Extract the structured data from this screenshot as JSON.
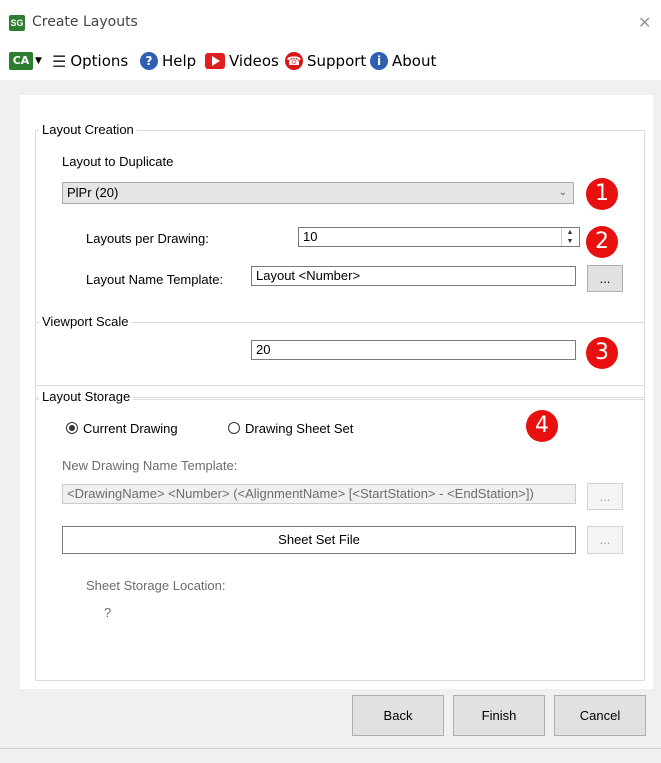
{
  "window": {
    "app_badge": "SG",
    "title": "Create Layouts",
    "close_glyph": "✕"
  },
  "toolbar": {
    "ca_badge": "CA",
    "items": [
      {
        "label": "Options",
        "icon": "list-icon"
      },
      {
        "label": "Help",
        "icon": "help-icon"
      },
      {
        "label": "Videos",
        "icon": "video-icon"
      },
      {
        "label": "Support",
        "icon": "support-icon"
      },
      {
        "label": "About",
        "icon": "info-icon"
      }
    ]
  },
  "layout_creation": {
    "legend": "Layout Creation",
    "duplicate_label": "Layout to Duplicate",
    "duplicate_value": "PlPr (20)",
    "per_drawing_label": "Layouts per Drawing:",
    "per_drawing_value": "10",
    "name_template_label": "Layout Name Template:",
    "name_template_value": "Layout <Number>",
    "browse_label": "..."
  },
  "viewport": {
    "legend": "Viewport Scale",
    "value": "20"
  },
  "storage": {
    "legend": "Layout Storage",
    "radio_current": "Current Drawing",
    "radio_sheet_set": "Drawing Sheet Set",
    "selected": "Current Drawing",
    "new_drawing_label": "New Drawing Name Template:",
    "new_drawing_value": "<DrawingName> <Number> (<AlignmentName> [<StartStation> - <EndStation>])",
    "sheet_set_file": "Sheet Set File",
    "browse_label": "...",
    "location_label": "Sheet Storage Location:",
    "location_value": "?"
  },
  "badges": [
    "1",
    "2",
    "3",
    "4"
  ],
  "footer": {
    "back": "Back",
    "finish": "Finish",
    "cancel": "Cancel"
  },
  "colors": {
    "badge_red": "#e80f0f",
    "brand_green": "#2e7d32"
  }
}
